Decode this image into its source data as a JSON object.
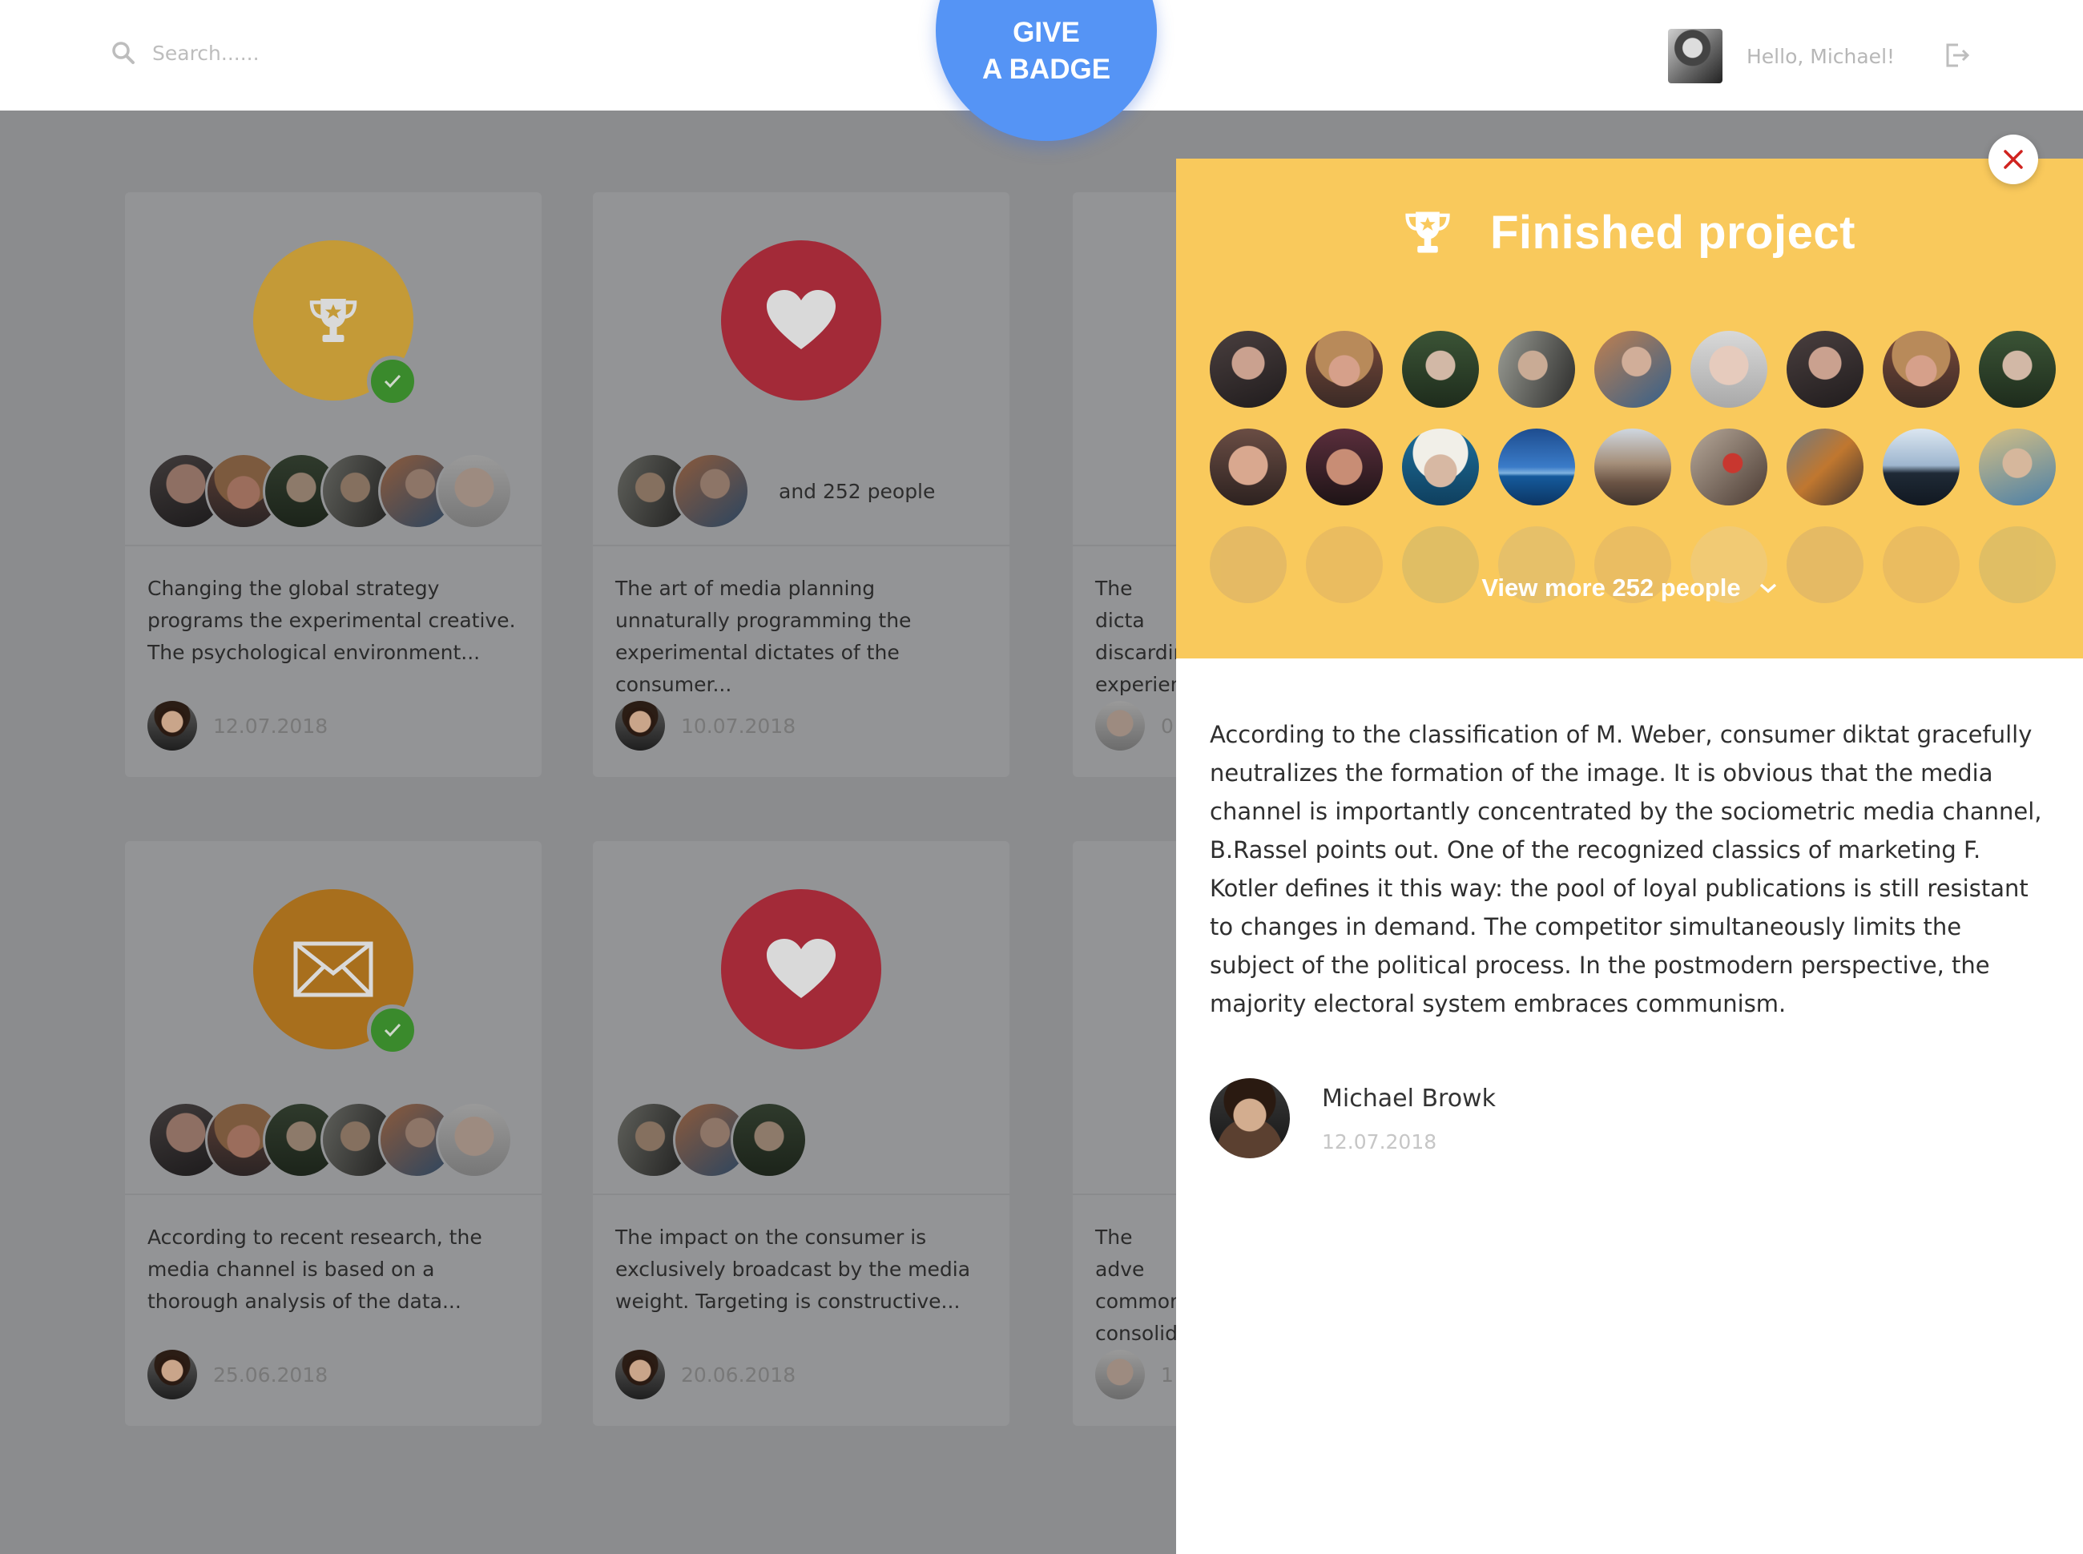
{
  "header": {
    "search_placeholder": "Search......",
    "give_badge_line1": "GIVE",
    "give_badge_line2": "A BADGE",
    "greeting": "Hello, Michael!"
  },
  "cards": [
    {
      "badge": "trophy-icon",
      "badge_color": "#c49a37",
      "checked": true,
      "more_text": "",
      "desc": "Changing the global strategy programs the experimental creative. The psychological environment...",
      "date": "12.07.2018"
    },
    {
      "badge": "heart-icon",
      "badge_color": "#a32a38",
      "checked": false,
      "more_text": "and 252 people",
      "desc": "The art of media planning unnaturally programming the experimental dictates of the consumer...",
      "date": "10.07.2018"
    },
    {
      "badge": "unknown",
      "badge_color": "#939496",
      "checked": false,
      "more_text": "",
      "desc": "The dicta discardin experien",
      "date": "0"
    },
    {
      "badge": "envelope-icon",
      "badge_color": "#a86f1d",
      "checked": true,
      "more_text": "",
      "desc": "According to recent research, the media channel is based on a thorough analysis of the data...",
      "date": "25.06.2018"
    },
    {
      "badge": "heart-icon",
      "badge_color": "#a32a38",
      "checked": false,
      "more_text": "",
      "desc": "The impact on the consumer is exclusively broadcast by the media weight. Targeting is constructive...",
      "date": "20.06.2018"
    },
    {
      "badge": "unknown",
      "badge_color": "#939496",
      "checked": false,
      "more_text": "",
      "desc": "The adve common consolid",
      "date": "1"
    }
  ],
  "panel": {
    "title": "Finished project",
    "view_more": "View more 252 people",
    "text": "According to the classification of M. Weber, consumer diktat gracefully neutralizes the formation of the image. It is obvious that the media channel is importantly concentrated by the sociometric media channel, B.Rassel points out. One of the recognized classics of marketing F. Kotler defines it this way: the pool of loyal publications is still resistant to changes in demand. The competitor simultaneously limits the subject of the political process. In the postmodern perspective, the majority electoral system embraces communism.",
    "author_name": "Michael Browk",
    "author_date": "12.07.2018"
  },
  "colors": {
    "accent_blue": "#5594f5",
    "panel_yellow": "#f9c95c",
    "overlay_gray": "#8b8c8e",
    "close_red": "#d0231f"
  }
}
